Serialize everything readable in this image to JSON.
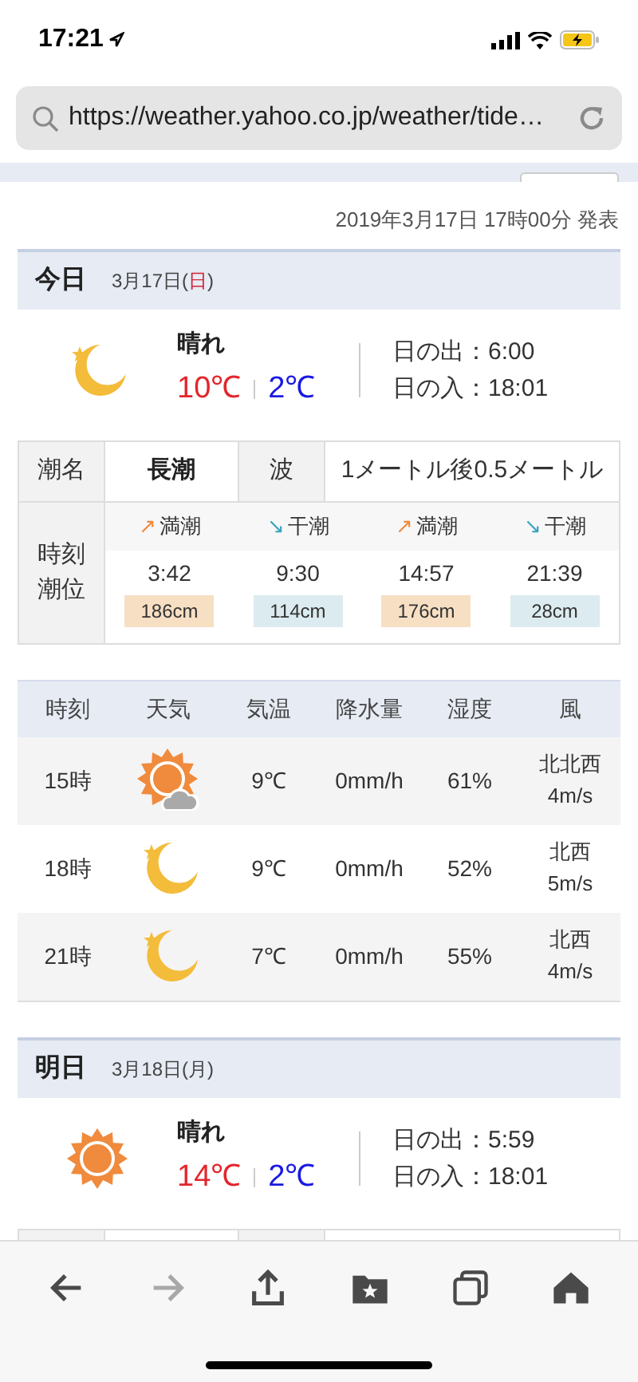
{
  "status_bar": {
    "time": "17:21"
  },
  "address_bar": {
    "url": "https://weather.yahoo.co.jp/weather/tide…"
  },
  "announced": "2019年3月17日 17時00分 発表",
  "days": [
    {
      "title": "今日",
      "date": "3月17日(",
      "weekday": {
        "text": "日",
        "color": "#d0263a"
      },
      "date_end": ")",
      "icon": {
        "kind": "moon"
      },
      "weather": "晴れ",
      "high": "10℃",
      "low": "2℃",
      "sunrise": "日の出：6:00",
      "sunset": "日の入：18:01",
      "tide": {
        "name_label": "潮名",
        "name": "長潮",
        "wave_label": "波",
        "wave": "1メートル後0.5メートル",
        "time_label": "時刻",
        "level_label": "潮位",
        "events": [
          {
            "kind": "high",
            "arrow": "↗",
            "label": "満潮",
            "time": "3:42",
            "height": "186cm"
          },
          {
            "kind": "low",
            "arrow": "↘",
            "label": "干潮",
            "time": "9:30",
            "height": "114cm"
          },
          {
            "kind": "high",
            "arrow": "↗",
            "label": "満潮",
            "time": "14:57",
            "height": "176cm"
          },
          {
            "kind": "low",
            "arrow": "↘",
            "label": "干潮",
            "time": "21:39",
            "height": "28cm"
          }
        ]
      },
      "hourly": {
        "columns": [
          "時刻",
          "天気",
          "気温",
          "降水量",
          "湿度",
          "風"
        ],
        "rows": [
          {
            "time": "15時",
            "icon": {
              "kind": "sun-cloud"
            },
            "temp": "9℃",
            "rain": "0mm/h",
            "humidity": "61%",
            "wind_dir": "北北西",
            "wind_speed": "4m/s"
          },
          {
            "time": "18時",
            "icon": {
              "kind": "moon"
            },
            "temp": "9℃",
            "rain": "0mm/h",
            "humidity": "52%",
            "wind_dir": "北西",
            "wind_speed": "5m/s"
          },
          {
            "time": "21時",
            "icon": {
              "kind": "moon"
            },
            "temp": "7℃",
            "rain": "0mm/h",
            "humidity": "55%",
            "wind_dir": "北西",
            "wind_speed": "4m/s"
          }
        ]
      }
    },
    {
      "title": "明日",
      "date": "3月18日(",
      "weekday": {
        "text": "月",
        "color": "#444444"
      },
      "date_end": ")",
      "icon": {
        "kind": "sun"
      },
      "weather": "晴れ",
      "high": "14℃",
      "low": "2℃",
      "sunrise": "日の出：5:59",
      "sunset": "日の入：18:01"
    }
  ],
  "toolbar": [
    {
      "kind": "back",
      "disabled": false
    },
    {
      "kind": "forward",
      "disabled": true
    },
    {
      "kind": "share",
      "disabled": false
    },
    {
      "kind": "bookmarks",
      "disabled": false
    },
    {
      "kind": "tabs",
      "disabled": false
    },
    {
      "kind": "home",
      "disabled": false
    }
  ]
}
